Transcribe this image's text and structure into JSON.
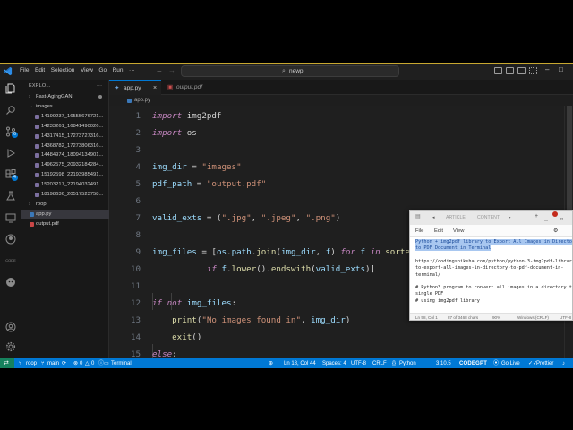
{
  "titlebar": {
    "menu": [
      "File",
      "Edit",
      "Selection",
      "View",
      "Go",
      "Run"
    ],
    "command_center": "newp",
    "menu_more": "···"
  },
  "activity_bar": {
    "items": [
      "explorer-icon",
      "search-icon",
      "source-control-icon",
      "run-debug-icon",
      "extensions-icon",
      "testing-icon",
      "remote-explorer-icon",
      "github-icon",
      "codegpt-icon",
      "accounts-icon",
      "settings-icon"
    ],
    "source_control_badge": "6",
    "extensions_badge": "4",
    "codegpt_label": "CODE"
  },
  "sidebar": {
    "header": "EXPLO...",
    "more": "···",
    "tree": [
      {
        "label": "Fast-AgingGAN",
        "type": "folder-collapsed",
        "depth": 0
      },
      {
        "label": "images",
        "type": "folder-open",
        "depth": 0
      },
      {
        "label": "14199237_16555676721...",
        "type": "image",
        "depth": 1
      },
      {
        "label": "14233261_16841490026...",
        "type": "image",
        "depth": 1
      },
      {
        "label": "14317415_17273727316...",
        "type": "image",
        "depth": 1
      },
      {
        "label": "14368782_17273806316...",
        "type": "image",
        "depth": 1
      },
      {
        "label": "14484974_18094134901...",
        "type": "image",
        "depth": 1
      },
      {
        "label": "14962575_20932184284...",
        "type": "image",
        "depth": 1
      },
      {
        "label": "15192598_22193985491...",
        "type": "image",
        "depth": 1
      },
      {
        "label": "15203217_22194032491...",
        "type": "image",
        "depth": 1
      },
      {
        "label": "18198636_20517523758...",
        "type": "image",
        "depth": 1
      },
      {
        "label": "roop",
        "type": "folder-collapsed",
        "depth": 0
      },
      {
        "label": "app.py",
        "type": "python",
        "depth": 0,
        "selected": true
      },
      {
        "label": "output.pdf",
        "type": "pdf",
        "depth": 0
      }
    ]
  },
  "tabs": [
    {
      "label": "app.py",
      "active": true,
      "close": "×"
    },
    {
      "label": "output.pdf",
      "active": false,
      "close": ""
    }
  ],
  "breadcrumb": "app.py",
  "editor": {
    "lines": [
      {
        "n": "1",
        "tokens": [
          [
            "kw",
            "import"
          ],
          [
            "mod",
            " img2pdf"
          ]
        ]
      },
      {
        "n": "2",
        "tokens": [
          [
            "kw",
            "import"
          ],
          [
            "mod",
            " os"
          ]
        ]
      },
      {
        "n": "3",
        "tokens": []
      },
      {
        "n": "4",
        "tokens": [
          [
            "var",
            "img_dir"
          ],
          [
            "mod",
            " = "
          ],
          [
            "str",
            "\"images\""
          ]
        ]
      },
      {
        "n": "5",
        "tokens": [
          [
            "var",
            "pdf_path"
          ],
          [
            "mod",
            " = "
          ],
          [
            "str",
            "\"output.pdf\""
          ]
        ]
      },
      {
        "n": "6",
        "tokens": []
      },
      {
        "n": "7",
        "tokens": [
          [
            "var",
            "valid_exts"
          ],
          [
            "mod",
            " = ("
          ],
          [
            "str",
            "\".jpg\""
          ],
          [
            "mod",
            ", "
          ],
          [
            "str",
            "\".jpeg\""
          ],
          [
            "mod",
            ", "
          ],
          [
            "str",
            "\".png\""
          ],
          [
            "mod",
            ")"
          ]
        ]
      },
      {
        "n": "8",
        "tokens": []
      },
      {
        "n": "9",
        "tokens": [
          [
            "var",
            "img_files"
          ],
          [
            "mod",
            " = ["
          ],
          [
            "var",
            "os"
          ],
          [
            "mod",
            "."
          ],
          [
            "var",
            "path"
          ],
          [
            "mod",
            "."
          ],
          [
            "fn",
            "join"
          ],
          [
            "mod",
            "("
          ],
          [
            "var",
            "img_dir"
          ],
          [
            "mod",
            ", "
          ],
          [
            "var",
            "f"
          ],
          [
            "mod",
            ") "
          ],
          [
            "kw",
            "for"
          ],
          [
            "mod",
            " "
          ],
          [
            "var",
            "f"
          ],
          [
            "mod",
            " "
          ],
          [
            "kw",
            "in"
          ],
          [
            "mod",
            " "
          ],
          [
            "fn",
            "sorted"
          ],
          [
            "mod",
            "(o"
          ]
        ]
      },
      {
        "n": "10",
        "tokens": [
          [
            "mod",
            "           "
          ],
          [
            "kw",
            "if"
          ],
          [
            "mod",
            " "
          ],
          [
            "var",
            "f"
          ],
          [
            "mod",
            "."
          ],
          [
            "fn",
            "lower"
          ],
          [
            "mod",
            "()."
          ],
          [
            "fn",
            "endswith"
          ],
          [
            "mod",
            "("
          ],
          [
            "var",
            "valid_exts"
          ],
          [
            "mod",
            ")]"
          ]
        ]
      },
      {
        "n": "11",
        "tokens": []
      },
      {
        "n": "12",
        "tokens": [
          [
            "kw",
            "if"
          ],
          [
            "mod",
            " "
          ],
          [
            "kw",
            "not"
          ],
          [
            "mod",
            " "
          ],
          [
            "var",
            "img_files"
          ],
          [
            "mod",
            ":"
          ]
        ]
      },
      {
        "n": "13",
        "tokens": [
          [
            "mod",
            "    "
          ],
          [
            "fn",
            "print"
          ],
          [
            "mod",
            "("
          ],
          [
            "str",
            "\"No images found in\""
          ],
          [
            "mod",
            ", "
          ],
          [
            "var",
            "img_dir"
          ],
          [
            "mod",
            ")"
          ]
        ]
      },
      {
        "n": "14",
        "tokens": [
          [
            "mod",
            "    "
          ],
          [
            "fn",
            "exit"
          ],
          [
            "mod",
            "()"
          ]
        ]
      },
      {
        "n": "15",
        "tokens": [
          [
            "kw",
            "else"
          ],
          [
            "mod",
            ":"
          ]
        ]
      }
    ]
  },
  "notepad": {
    "tabs": [
      "...",
      "ARTICLE",
      "CONTENT",
      "+"
    ],
    "menu": [
      "File",
      "Edit",
      "View"
    ],
    "lines": [
      {
        "text": "Python + img2pdf library to Export All Images in Directory",
        "highlight": true
      },
      {
        "text": "to PDF Document in Terminal",
        "highlight": true
      },
      {
        "text": "",
        "highlight": false
      },
      {
        "text": "https://codingshiksha.com/python/python-3-img2pdf-library-",
        "highlight": false
      },
      {
        "text": "to-export-all-images-in-directory-to-pdf-document-in-",
        "highlight": false
      },
      {
        "text": "terminal/",
        "highlight": false
      },
      {
        "text": "",
        "highlight": false
      },
      {
        "text": "# Python3 program to convert all images in a directory to a",
        "highlight": false
      },
      {
        "text": "single PDF",
        "highlight": false
      },
      {
        "text": "# using img2pdf library",
        "highlight": false
      }
    ],
    "status": [
      "Ln 58, Col 1",
      "87 of 3468 chars",
      "90%",
      "Windows (CRLF)",
      "UTF-8"
    ]
  },
  "statusbar": {
    "left": [
      "roop",
      "main",
      "0",
      "0",
      "0",
      "Terminal"
    ],
    "right": [
      "Ln 18, Col 44",
      "Spaces: 4",
      "UTF-8",
      "CRLF",
      "Python",
      "3.10.5",
      "CODEGPT",
      "Go Live",
      "Prettier"
    ]
  }
}
